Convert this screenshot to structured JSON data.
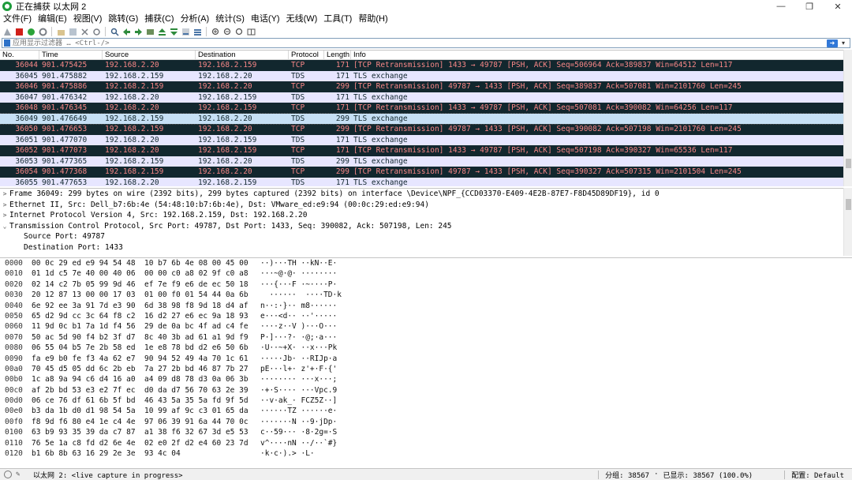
{
  "window": {
    "title": "正在捕获 以太网 2",
    "minimize": "—",
    "maximize": "❐",
    "close": "✕"
  },
  "menu": [
    "文件(F)",
    "编辑(E)",
    "视图(V)",
    "跳转(G)",
    "捕获(C)",
    "分析(A)",
    "统计(S)",
    "电话(Y)",
    "无线(W)",
    "工具(T)",
    "帮助(H)"
  ],
  "filter": {
    "placeholder": "应用显示过滤器 … <Ctrl-/>",
    "value": ""
  },
  "columns": [
    "No.",
    "Time",
    "Source",
    "Destination",
    "Protocol",
    "Length",
    "Info"
  ],
  "packets": [
    {
      "no": "36044",
      "time": "901.475425",
      "src": "192.168.2.20",
      "dst": "192.168.2.159",
      "proto": "TCP",
      "len": "171",
      "info": "[TCP Retransmission] 1433 → 49787 [PSH, ACK] Seq=506964 Ack=389837 Win=64512 Len=117",
      "style": "dark"
    },
    {
      "no": "36045",
      "time": "901.475882",
      "src": "192.168.2.159",
      "dst": "192.168.2.20",
      "proto": "TDS",
      "len": "171",
      "info": "TLS exchange",
      "style": "light"
    },
    {
      "no": "36046",
      "time": "901.475886",
      "src": "192.168.2.159",
      "dst": "192.168.2.20",
      "proto": "TCP",
      "len": "299",
      "info": "[TCP Retransmission] 49787 → 1433 [PSH, ACK] Seq=389837 Ack=507081 Win=2101760 Len=245",
      "style": "dark"
    },
    {
      "no": "36047",
      "time": "901.476342",
      "src": "192.168.2.20",
      "dst": "192.168.2.159",
      "proto": "TDS",
      "len": "171",
      "info": "TLS exchange",
      "style": "light"
    },
    {
      "no": "36048",
      "time": "901.476345",
      "src": "192.168.2.20",
      "dst": "192.168.2.159",
      "proto": "TCP",
      "len": "171",
      "info": "[TCP Retransmission] 1433 → 49787 [PSH, ACK] Seq=507081 Ack=390082 Win=64256 Len=117",
      "style": "dark"
    },
    {
      "no": "36049",
      "time": "901.476649",
      "src": "192.168.2.159",
      "dst": "192.168.2.20",
      "proto": "TDS",
      "len": "299",
      "info": "TLS exchange",
      "style": "sel"
    },
    {
      "no": "36050",
      "time": "901.476653",
      "src": "192.168.2.159",
      "dst": "192.168.2.20",
      "proto": "TCP",
      "len": "299",
      "info": "[TCP Retransmission] 49787 → 1433 [PSH, ACK] Seq=390082 Ack=507198 Win=2101760 Len=245",
      "style": "dark"
    },
    {
      "no": "36051",
      "time": "901.477070",
      "src": "192.168.2.20",
      "dst": "192.168.2.159",
      "proto": "TDS",
      "len": "171",
      "info": "TLS exchange",
      "style": "light"
    },
    {
      "no": "36052",
      "time": "901.477073",
      "src": "192.168.2.20",
      "dst": "192.168.2.159",
      "proto": "TCP",
      "len": "171",
      "info": "[TCP Retransmission] 1433 → 49787 [PSH, ACK] Seq=507198 Ack=390327 Win=65536 Len=117",
      "style": "dark"
    },
    {
      "no": "36053",
      "time": "901.477365",
      "src": "192.168.2.159",
      "dst": "192.168.2.20",
      "proto": "TDS",
      "len": "299",
      "info": "TLS exchange",
      "style": "light"
    },
    {
      "no": "36054",
      "time": "901.477368",
      "src": "192.168.2.159",
      "dst": "192.168.2.20",
      "proto": "TCP",
      "len": "299",
      "info": "[TCP Retransmission] 49787 → 1433 [PSH, ACK] Seq=390327 Ack=507315 Win=2101504 Len=245",
      "style": "dark"
    },
    {
      "no": "36055",
      "time": "901.477653",
      "src": "192.168.2.20",
      "dst": "192.168.2.159",
      "proto": "TDS",
      "len": "171",
      "info": "TLS exchange",
      "style": "light"
    }
  ],
  "details": [
    {
      "arrow": ">",
      "text": "Frame 36049: 299 bytes on wire (2392 bits), 299 bytes captured (2392 bits) on interface \\Device\\NPF_{CCD03370-E409-4E2B-87E7-F8D45D89DF19}, id 0",
      "child": false
    },
    {
      "arrow": ">",
      "text": "Ethernet II, Src: Dell_b7:6b:4e (54:48:10:b7:6b:4e), Dst: VMware_ed:e9:94 (00:0c:29:ed:e9:94)",
      "child": false
    },
    {
      "arrow": ">",
      "text": "Internet Protocol Version 4, Src: 192.168.2.159, Dst: 192.168.2.20",
      "child": false
    },
    {
      "arrow": "⌄",
      "text": "Transmission Control Protocol, Src Port: 49787, Dst Port: 1433, Seq: 390082, Ack: 507198, Len: 245",
      "child": false
    },
    {
      "arrow": "",
      "text": "Source Port: 49787",
      "child": true
    },
    {
      "arrow": "",
      "text": "Destination Port: 1433",
      "child": true
    }
  ],
  "bytes": [
    {
      "off": "0000",
      "hex": "00 0c 29 ed e9 94 54 48  10 b7 6b 4e 08 00 45 00",
      "asc": "··)···TH ··kN··E·"
    },
    {
      "off": "0010",
      "hex": "01 1d c5 7e 40 00 40 06  00 00 c0 a8 02 9f c0 a8",
      "asc": "···~@·@· ········"
    },
    {
      "off": "0020",
      "hex": "02 14 c2 7b 05 99 9d 46  ef 7e f9 e6 de ec 50 18",
      "asc": "···{···F ·~····P·"
    },
    {
      "off": "0030",
      "hex": "20 12 87 13 00 00 17 03  01 00 f0 01 54 44 0a 6b",
      "asc": "  ······  ····TD·k"
    },
    {
      "off": "0040",
      "hex": "6e 92 ee 3a 91 7d e3 90  6d 38 98 f8 9d 18 d4 af",
      "asc": "n··:·}·· m8······"
    },
    {
      "off": "0050",
      "hex": "65 d2 9d cc 3c 64 f8 c2  16 d2 27 e6 ec 9a 18 93",
      "asc": "e···<d·· ··'·····"
    },
    {
      "off": "0060",
      "hex": "11 9d 0c b1 7a 1d f4 56  29 de 0a bc 4f ad c4 fe",
      "asc": "····z··V )···O···"
    },
    {
      "off": "0070",
      "hex": "50 ac 5d 90 f4 b2 3f d7  8c 40 3b ad 61 a1 9d f9",
      "asc": "P·]···?· ·@;·a···"
    },
    {
      "off": "0080",
      "hex": "06 55 04 b5 7e 2b 58 ed  1e e8 78 bd d2 e6 50 6b",
      "asc": "·U··~+X· ··x···Pk"
    },
    {
      "off": "0090",
      "hex": "fa e9 b0 fe f3 4a 62 e7  90 94 52 49 4a 70 1c 61",
      "asc": "·····Jb· ··RIJp·a"
    },
    {
      "off": "00a0",
      "hex": "70 45 d5 05 dd 6c 2b eb  7a 27 2b bd 46 87 7b 27",
      "asc": "pE···l+· z'+·F·{'"
    },
    {
      "off": "00b0",
      "hex": "1c a8 9a 94 c6 d4 16 a0  a4 09 d8 78 d3 0a 06 3b",
      "asc": "········ ···x···;"
    },
    {
      "off": "00c0",
      "hex": "af 2b bd 53 e3 e2 7f ec  d0 da d7 56 70 63 2e 39",
      "asc": "·+·S···· ···Vpc.9"
    },
    {
      "off": "00d0",
      "hex": "06 ce 76 df 61 6b 5f bd  46 43 5a 35 5a fd 9f 5d",
      "asc": "··v·ak_· FCZ5Z··]"
    },
    {
      "off": "00e0",
      "hex": "b3 da 1b d0 d1 98 54 5a  10 99 af 9c c3 01 65 da",
      "asc": "······TZ ······e·"
    },
    {
      "off": "00f0",
      "hex": "f8 9d f6 80 e4 1e c4 4e  97 06 39 91 6a 44 70 0c",
      "asc": "·······N ··9·jDp·"
    },
    {
      "off": "0100",
      "hex": "63 b9 93 35 39 da c7 87  a1 38 f6 32 67 3d e5 53",
      "asc": "c··59··· ·8·2g=·S"
    },
    {
      "off": "0110",
      "hex": "76 5e 1a c8 fd d2 6e 4e  02 e0 2f d2 e4 60 23 7d",
      "asc": "v^····nN ··/··`#}"
    },
    {
      "off": "0120",
      "hex": "b1 6b 8b 63 16 29 2e 3e  93 4c 04",
      "asc": "·k·c·).> ·L·"
    }
  ],
  "status": {
    "capture": "以太网 2: <live capture in progress>",
    "packets": "分组: 38567",
    "displayed": "已显示: 38567 (100.0%)",
    "profile": "配置: Default"
  },
  "colors": {
    "dark_row_bg": "#12272e",
    "dark_row_fg": "#f78787",
    "light_row_bg": "#e7e6ff",
    "selected_bg": "#c6e0f5"
  }
}
